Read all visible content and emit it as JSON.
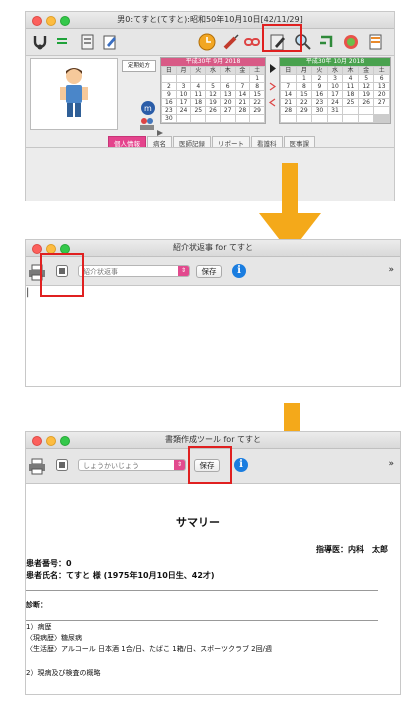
{
  "window1": {
    "title": "男0:てすと(てすと):昭和50年10月10日[42/11/29]",
    "left_panel_button": "定期処方",
    "calendar_left": {
      "header": "平成30年 9月 2018",
      "weekdays": [
        "日",
        "月",
        "火",
        "水",
        "木",
        "金",
        "土"
      ],
      "days": [
        "",
        "",
        "",
        "",
        "",
        "",
        "1",
        "2",
        "3",
        "4",
        "5",
        "6",
        "7",
        "8",
        "9",
        "10",
        "11",
        "12",
        "13",
        "14",
        "15",
        "16",
        "17",
        "18",
        "19",
        "20",
        "21",
        "22",
        "23",
        "24",
        "25",
        "26",
        "27",
        "28",
        "29",
        "30",
        "",
        "",
        "",
        "",
        "",
        ""
      ]
    },
    "calendar_right": {
      "header": "平成30年 10月 2018",
      "weekdays": [
        "日",
        "月",
        "火",
        "水",
        "木",
        "金",
        "土"
      ],
      "days": [
        "",
        "1",
        "2",
        "3",
        "4",
        "5",
        "6",
        "7",
        "8",
        "9",
        "10",
        "11",
        "12",
        "13",
        "14",
        "15",
        "16",
        "17",
        "18",
        "19",
        "20",
        "21",
        "22",
        "23",
        "24",
        "25",
        "26",
        "27",
        "28",
        "29",
        "30",
        "31",
        "",
        "",
        "",
        "",
        "",
        "",
        "",
        "",
        ""
      ]
    },
    "tabs": [
      "個人情報",
      "病名",
      "医師記録",
      "リポート",
      "看護科",
      "医事課"
    ],
    "active_tab": "個人情報"
  },
  "window2": {
    "title": "紹介状返事 for てすと",
    "select_value": "紹介状返事",
    "save_label": "保存",
    "overflow": "»",
    "cursor": "|"
  },
  "window3": {
    "title": "書類作成ツール for てすと",
    "select_value": "しょうかいじょう",
    "save_label": "保存",
    "overflow": "»",
    "doc": {
      "heading": "サマリー",
      "doctor": "指導医：内科　太郎",
      "patient_no": "患者番号：0",
      "patient_name": "患者氏名：てすと 様 (1975年10月10日生、42才)",
      "diagnosis": "診断：",
      "section1": "1）病歴",
      "present_illness": "〈現病歴〉糖尿病",
      "lifestyle": "〈生活歴〉アルコール 日本酒 1合/日、たばこ 1箱/日、スポーツクラブ 2回/週",
      "section2": "2）現病及び検査の概略"
    }
  },
  "colors": {
    "arrow": "#f4a91a",
    "highlight": "#e02020",
    "accent_pink": "#e4438c",
    "info_blue": "#1a7de0"
  }
}
